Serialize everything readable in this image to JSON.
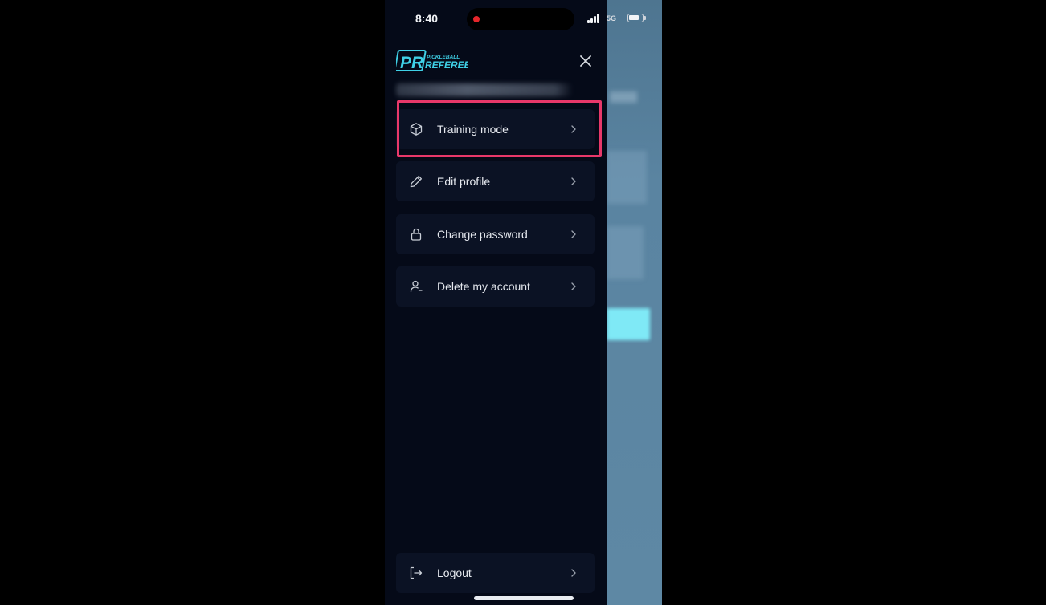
{
  "status_bar": {
    "time": "8:40",
    "network": "5G"
  },
  "logo": {
    "mark": "PR",
    "line1": "PICKLEBALL",
    "line2": "REFEREE"
  },
  "menu": {
    "items": [
      {
        "label": "Training mode",
        "icon": "cube-icon"
      },
      {
        "label": "Edit profile",
        "icon": "pencil-icon"
      },
      {
        "label": "Change password",
        "icon": "lock-icon"
      },
      {
        "label": "Delete my account",
        "icon": "user-remove-icon"
      }
    ],
    "logout": {
      "label": "Logout",
      "icon": "logout-icon"
    }
  },
  "colors": {
    "drawer_bg": "#050a18",
    "item_bg": "#0b1224",
    "accent": "#3fd0e6",
    "highlight": "#e8386a"
  }
}
